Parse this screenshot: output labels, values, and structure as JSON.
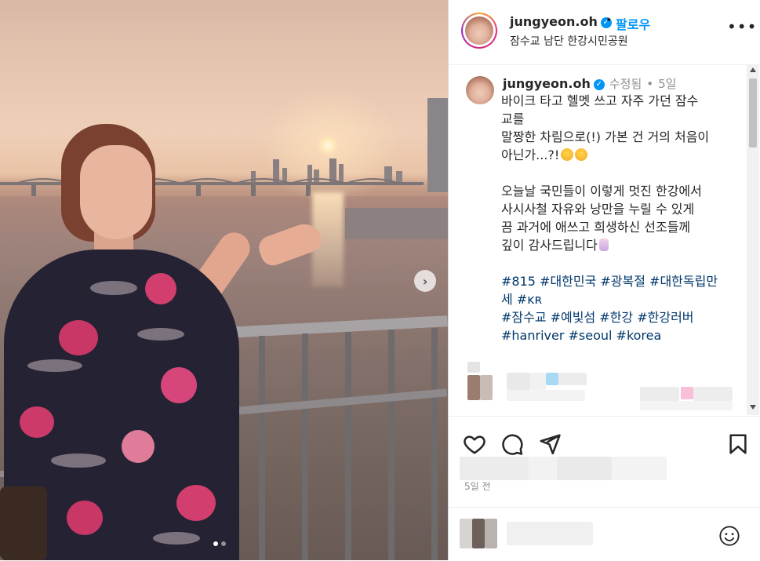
{
  "post": {
    "username": "jungyeon.oh",
    "follow_label": "팔로우",
    "separator": "•",
    "location": "잠수교 남단 한강시민공원"
  },
  "caption": {
    "username": "jungyeon.oh",
    "edited_label": "수정됨",
    "age": "5일",
    "lines": [
      "바이크 타고 헬멧 쓰고 자주 가던 잠수",
      "교를",
      "말짱한 차림으로(!) 가본 건 거의 처음이",
      "아닌가...?!",
      "",
      "오늘날 국민들이 이렇게 멋진 한강에서",
      "사시사철 자유와 낭만을 누릴 수 있게",
      "끔 과거에 애쓰고 희생하신 선조들께",
      "깊이 감사드립니다"
    ],
    "hashtag_lines": [
      "#815 #대한민국 #광복절 #대한독립만",
      "세 #ᴋʀ",
      "#잠수교 #예빛섬 #한강 #한강러버",
      "#hanriver #seoul #korea"
    ]
  },
  "footer": {
    "date": "5일 전"
  },
  "icons": {
    "verified": "verified-badge-icon",
    "more": "more-options-icon",
    "like": "heart-icon",
    "comment": "comment-icon",
    "share": "send-icon",
    "save": "bookmark-icon",
    "emoji": "smiley-icon",
    "next": "chevron-right-icon"
  },
  "colors": {
    "link": "#0095f6",
    "hashtag": "#00376b",
    "muted": "#8e8e8e",
    "text": "#262626"
  }
}
